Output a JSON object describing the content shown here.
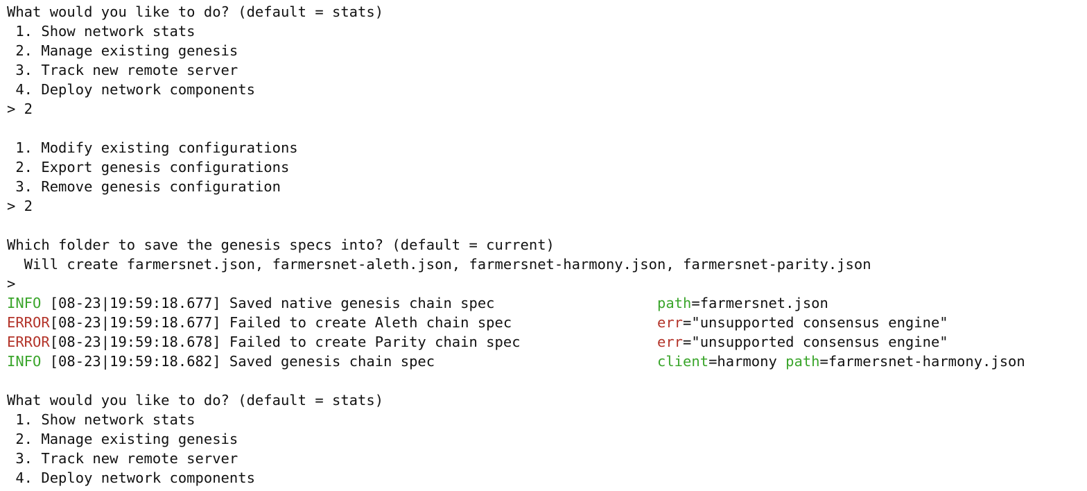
{
  "colors": {
    "info": "#3aa52b",
    "error": "#b3342a",
    "key": "#3aa52b",
    "text": "#111111",
    "background": "#ffffff"
  },
  "menu1": {
    "prompt": "What would you like to do? (default = stats)",
    "options": [
      " 1. Show network stats",
      " 2. Manage existing genesis",
      " 3. Track new remote server",
      " 4. Deploy network components"
    ],
    "input": "> 2"
  },
  "menu2": {
    "options": [
      " 1. Modify existing configurations",
      " 2. Export genesis configurations",
      " 3. Remove genesis configuration"
    ],
    "input": "> 2"
  },
  "folder": {
    "prompt": "Which folder to save the genesis specs into? (default = current)",
    "note": "  Will create farmersnet.json, farmersnet-aleth.json, farmersnet-harmony.json, farmersnet-parity.json",
    "input": ">"
  },
  "logs": [
    {
      "level": "INFO ",
      "rest": "[08-23|19:59:18.677] Saved native genesis chain spec",
      "k1": "path",
      "v1": "=farmersnet.json",
      "k2": "",
      "v2": ""
    },
    {
      "level": "ERROR",
      "rest": "[08-23|19:59:18.677] Failed to create Aleth chain spec",
      "k1": "err",
      "v1": "=\"unsupported consensus engine\"",
      "k2": "",
      "v2": ""
    },
    {
      "level": "ERROR",
      "rest": "[08-23|19:59:18.678] Failed to create Parity chain spec",
      "k1": "err",
      "v1": "=\"unsupported consensus engine\"",
      "k2": "",
      "v2": ""
    },
    {
      "level": "INFO ",
      "rest": "[08-23|19:59:18.682] Saved genesis chain spec",
      "k1": "client",
      "v1": "=harmony ",
      "k2": "path",
      "v2": "=farmersnet-harmony.json"
    }
  ],
  "menu3": {
    "prompt": "What would you like to do? (default = stats)",
    "options": [
      " 1. Show network stats",
      " 2. Manage existing genesis",
      " 3. Track new remote server",
      " 4. Deploy network components"
    ]
  }
}
